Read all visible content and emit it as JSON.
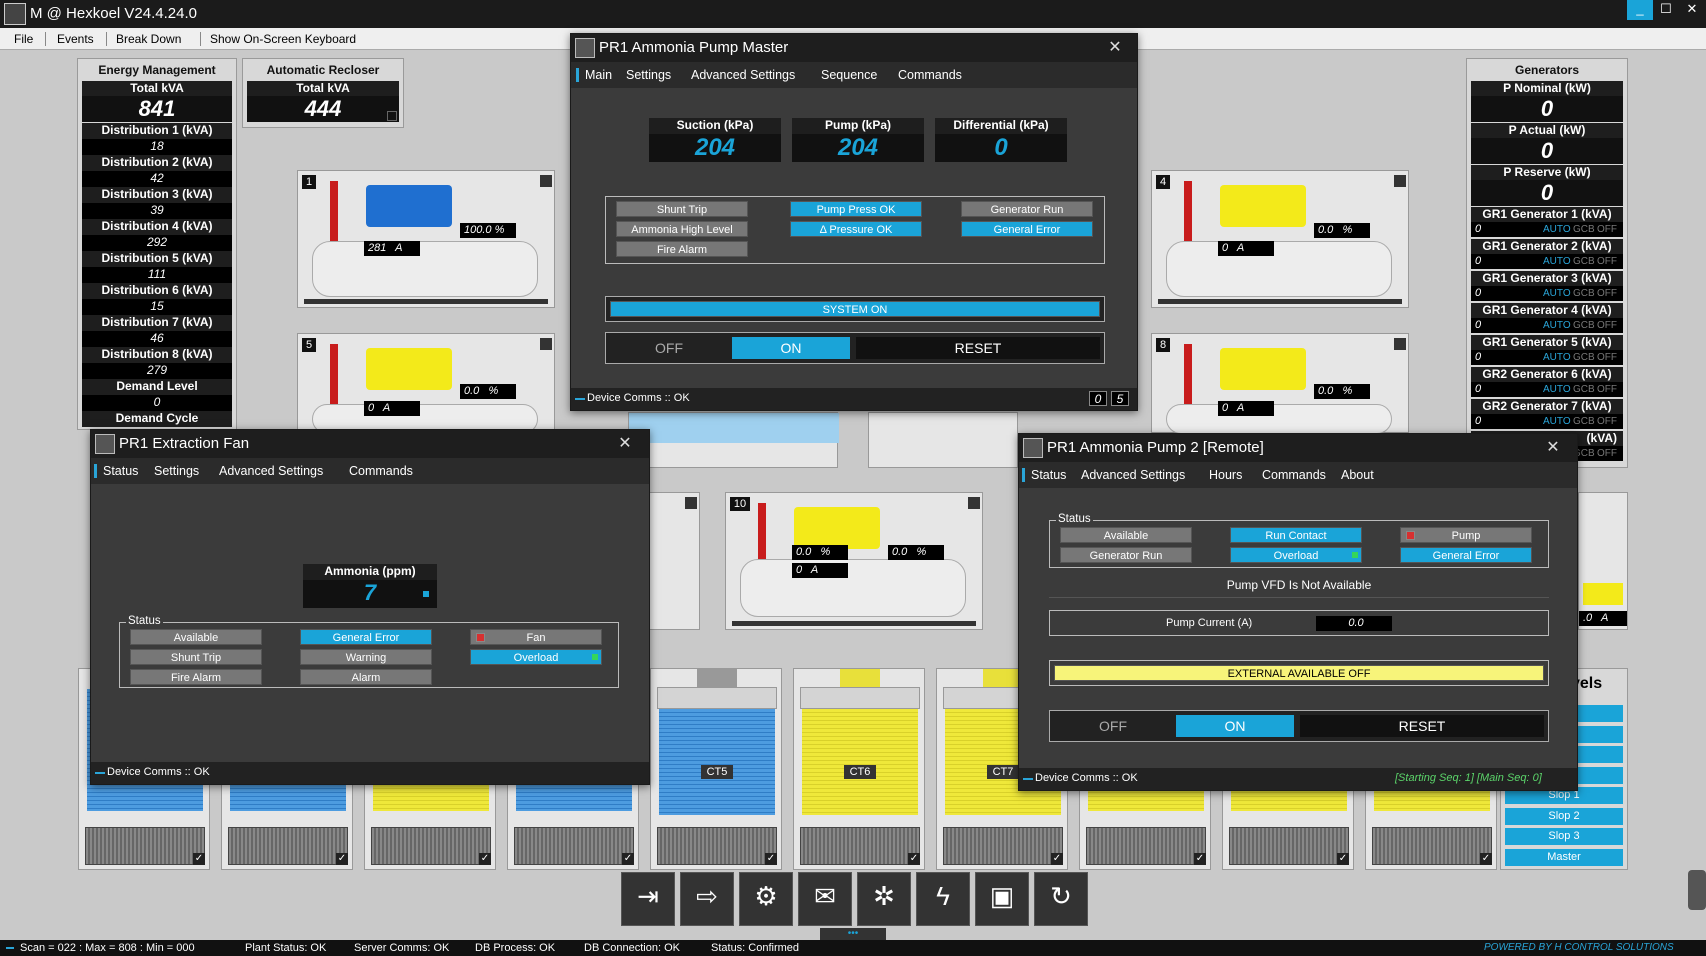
{
  "app": {
    "title": "M @ Hexkoel V24.4.24.0",
    "minimize": "_",
    "maximize": "☐",
    "close": "✕"
  },
  "menu": {
    "file": "File",
    "events": "Events",
    "breakdown": "Break Down",
    "keyboard": "Show On-Screen Keyboard"
  },
  "energy": {
    "title": "Energy Management",
    "total_label": "Total kVA",
    "total": "841",
    "dists": [
      {
        "label": "Distribution 1 (kVA)",
        "value": "18"
      },
      {
        "label": "Distribution 2 (kVA)",
        "value": "42"
      },
      {
        "label": "Distribution 3 (kVA)",
        "value": "39"
      },
      {
        "label": "Distribution 4 (kVA)",
        "value": "292"
      },
      {
        "label": "Distribution 5 (kVA)",
        "value": "111"
      },
      {
        "label": "Distribution 6 (kVA)",
        "value": "15"
      },
      {
        "label": "Distribution 7 (kVA)",
        "value": "46"
      },
      {
        "label": "Distribution 8 (kVA)",
        "value": "279"
      }
    ],
    "demand_level_label": "Demand Level",
    "demand_level": "0",
    "demand_cycle_label": "Demand Cycle"
  },
  "recloser": {
    "title": "Automatic Recloser",
    "total_label": "Total kVA",
    "total": "444"
  },
  "generators": {
    "title": "Generators",
    "p_nominal_label": "P Nominal (kW)",
    "p_nominal": "0",
    "p_actual_label": "P Actual (kW)",
    "p_actual": "0",
    "p_reserve_label": "P Reserve (kW)",
    "p_reserve": "0",
    "list": [
      {
        "label": "GR1 Generator 1 (kVA)",
        "value": "0"
      },
      {
        "label": "GR1 Generator 2 (kVA)",
        "value": "0"
      },
      {
        "label": "GR1 Generator 3 (kVA)",
        "value": "0"
      },
      {
        "label": "GR1 Generator 4 (kVA)",
        "value": "0"
      },
      {
        "label": "GR1 Generator 5 (kVA)",
        "value": "0"
      },
      {
        "label": "GR2 Generator 6 (kVA)",
        "value": "0"
      },
      {
        "label": "GR2 Generator 7 (kVA)",
        "value": "0"
      }
    ],
    "partial_label": "(kVA)",
    "auto": "AUTO",
    "gcb": "GCB",
    "off": "OFF"
  },
  "compressors": [
    {
      "num": "1",
      "amps": "281",
      "amp_unit": "A",
      "pct": "100.0",
      "pct_unit": "%"
    },
    {
      "num": "4",
      "amps": "0",
      "amp_unit": "A",
      "pct": "0.0",
      "pct_unit": "%"
    },
    {
      "num": "5",
      "amps": "0",
      "amp_unit": "A",
      "pct": "0.0",
      "pct_unit": "%"
    },
    {
      "num": "8",
      "amps": "0",
      "amp_unit": "A",
      "pct": "0.0",
      "pct_unit": "%"
    },
    {
      "num": "10",
      "amps": "0",
      "amp_unit": "A",
      "pct": "0.0",
      "pct_unit": "%",
      "pct2": "0.0"
    }
  ],
  "master": {
    "title": "PR1 Ammonia Pump Master",
    "tabs": [
      "Main",
      "Settings",
      "Advanced Settings",
      "Sequence",
      "Commands"
    ],
    "suction_label": "Suction (kPa)",
    "suction": "204",
    "pump_label": "Pump (kPa)",
    "pump": "204",
    "diff_label": "Differential (kPa)",
    "diff": "0",
    "shunt_trip": "Shunt Trip",
    "ammonia_high": "Ammonia High Level",
    "fire_alarm": "Fire Alarm",
    "pump_press_ok": "Pump Press OK",
    "delta_press_ok": "Δ Pressure OK",
    "generator_run": "Generator Run",
    "general_error": "General Error",
    "system_on": "SYSTEM ON",
    "off": "OFF",
    "on": "ON",
    "reset": "RESET",
    "comms": "Device Comms :: OK",
    "seq1": "0",
    "seq2": "5"
  },
  "fan": {
    "title": "PR1 Extraction Fan",
    "tabs": [
      "Status",
      "Settings",
      "Advanced Settings",
      "Commands"
    ],
    "ammonia_label": "Ammonia (ppm)",
    "ammonia": "7",
    "status": "Status",
    "available": "Available",
    "shunt_trip": "Shunt Trip",
    "fire_alarm": "Fire Alarm",
    "general_error": "General Error",
    "warning": "Warning",
    "alarm": "Alarm",
    "fan": "Fan",
    "overload": "Overload",
    "comms": "Device Comms :: OK"
  },
  "pump2": {
    "title": "PR1 Ammonia Pump 2 [Remote]",
    "tabs": [
      "Status",
      "Advanced Settings",
      "Hours",
      "Commands",
      "About"
    ],
    "status": "Status",
    "available": "Available",
    "generator_run": "Generator Run",
    "run_contact": "Run Contact",
    "overload": "Overload",
    "pump": "Pump",
    "general_error": "General Error",
    "vfd": "Pump VFD Is Not Available",
    "current_label": "Pump Current (A)",
    "current": "0.0",
    "external": "EXTERNAL AVAILABLE OFF",
    "off": "OFF",
    "on": "ON",
    "reset": "RESET",
    "comms": "Device Comms :: OK",
    "seq": "[Starting Seq: 1]  [Main Seq: 0]"
  },
  "tanks": [
    "CT5",
    "CT6",
    "CT7"
  ],
  "levels": {
    "title": "vels",
    "items": [
      "tor 1",
      "tor 2",
      "tor 3",
      "tor 4",
      "Slop 1",
      "Slop 2",
      "Slop 3",
      "Master"
    ]
  },
  "statusbar": {
    "scan": "Scan = 022 : Max = 808 : Min = 000",
    "plant": "Plant Status: OK",
    "server": "Server Comms: OK",
    "db": "DB Process:  OK",
    "dbconn": "DB Connection:  OK",
    "status": "Status:  Confirmed",
    "powered": "POWERED BY H CONTROL SOLUTIONS"
  },
  "misc": {
    "partial_pct": "%",
    "partial_amp": ".0",
    "partial_a": "A"
  }
}
